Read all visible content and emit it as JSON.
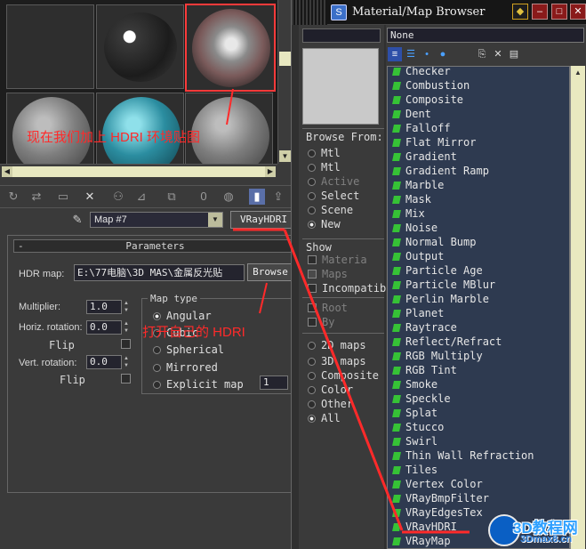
{
  "editor": {
    "map_name": "Map #7",
    "map_type_button": "VRayHDRI",
    "params_title": "Parameters",
    "params_collapse": "-",
    "hdr_map_label": "HDR map:",
    "hdr_map_path": "E:\\77电脑\\3D MAS\\金属反光贴",
    "browse_label": "Browse",
    "multiplier_label": "Multiplier:",
    "multiplier_value": "1.0",
    "horiz_rotation_label": "Horiz. rotation:",
    "horiz_rotation_value": "0.0",
    "flip_label_1": "Flip",
    "vert_rotation_label": "Vert. rotation:",
    "vert_rotation_value": "0.0",
    "flip_label_2": "Flip",
    "map_type_group": "Map type",
    "map_types": [
      "Angular",
      "Cubic",
      "Spherical",
      "Mirrored",
      "Explicit map"
    ],
    "map_type_selected": "Angular",
    "explicit_map_channel": "1",
    "annotation_top": "现在我们加上 HDRI 环境贴图",
    "annotation_mid": "打开自己的 HDRI"
  },
  "browser": {
    "title": "Material/Map Browser",
    "name_field": "None",
    "browse_from_title": "Browse From:",
    "browse_from": [
      {
        "label": "Mtl",
        "enabled": true,
        "checked": false
      },
      {
        "label": "Mtl",
        "enabled": true,
        "checked": false
      },
      {
        "label": "Active",
        "enabled": false,
        "checked": false
      },
      {
        "label": "Select",
        "enabled": true,
        "checked": false
      },
      {
        "label": "Scene",
        "enabled": true,
        "checked": false
      },
      {
        "label": "New",
        "enabled": true,
        "checked": true
      }
    ],
    "show_title": "Show",
    "show": [
      {
        "label": "Materia",
        "enabled": false,
        "checked": false
      },
      {
        "label": "Maps",
        "enabled": false,
        "checked": true
      },
      {
        "label": "Incompatib",
        "enabled": true,
        "checked": false
      }
    ],
    "extra": [
      {
        "label": "Root",
        "enabled": false
      },
      {
        "label": "By",
        "enabled": false
      }
    ],
    "categories": [
      {
        "label": "2D maps",
        "checked": false
      },
      {
        "label": "3D maps",
        "checked": false
      },
      {
        "label": "Composite",
        "checked": false
      },
      {
        "label": "Color",
        "checked": false
      },
      {
        "label": "Other",
        "checked": false
      },
      {
        "label": "All",
        "checked": true
      }
    ],
    "maps": [
      "Checker",
      "Combustion",
      "Composite",
      "Dent",
      "Falloff",
      "Flat Mirror",
      "Gradient",
      "Gradient Ramp",
      "Marble",
      "Mask",
      "Mix",
      "Noise",
      "Normal Bump",
      "Output",
      "Particle Age",
      "Particle MBlur",
      "Perlin Marble",
      "Planet",
      "Raytrace",
      "Reflect/Refract",
      "RGB Multiply",
      "RGB Tint",
      "Smoke",
      "Speckle",
      "Splat",
      "Stucco",
      "Swirl",
      "Thin Wall Refraction",
      "Tiles",
      "Vertex Color",
      "VRayBmpFilter",
      "VRayEdgesTex",
      "VRayHDRI",
      "VRayMap"
    ],
    "highlight_map": "VRayHDRI"
  },
  "watermark": {
    "big": "3D教程网",
    "small": "3Dmax8.cn"
  },
  "colors": {
    "annotation": "#ff2a2a",
    "list_bg": "#2e3a50",
    "map_icon": "#36c236"
  }
}
